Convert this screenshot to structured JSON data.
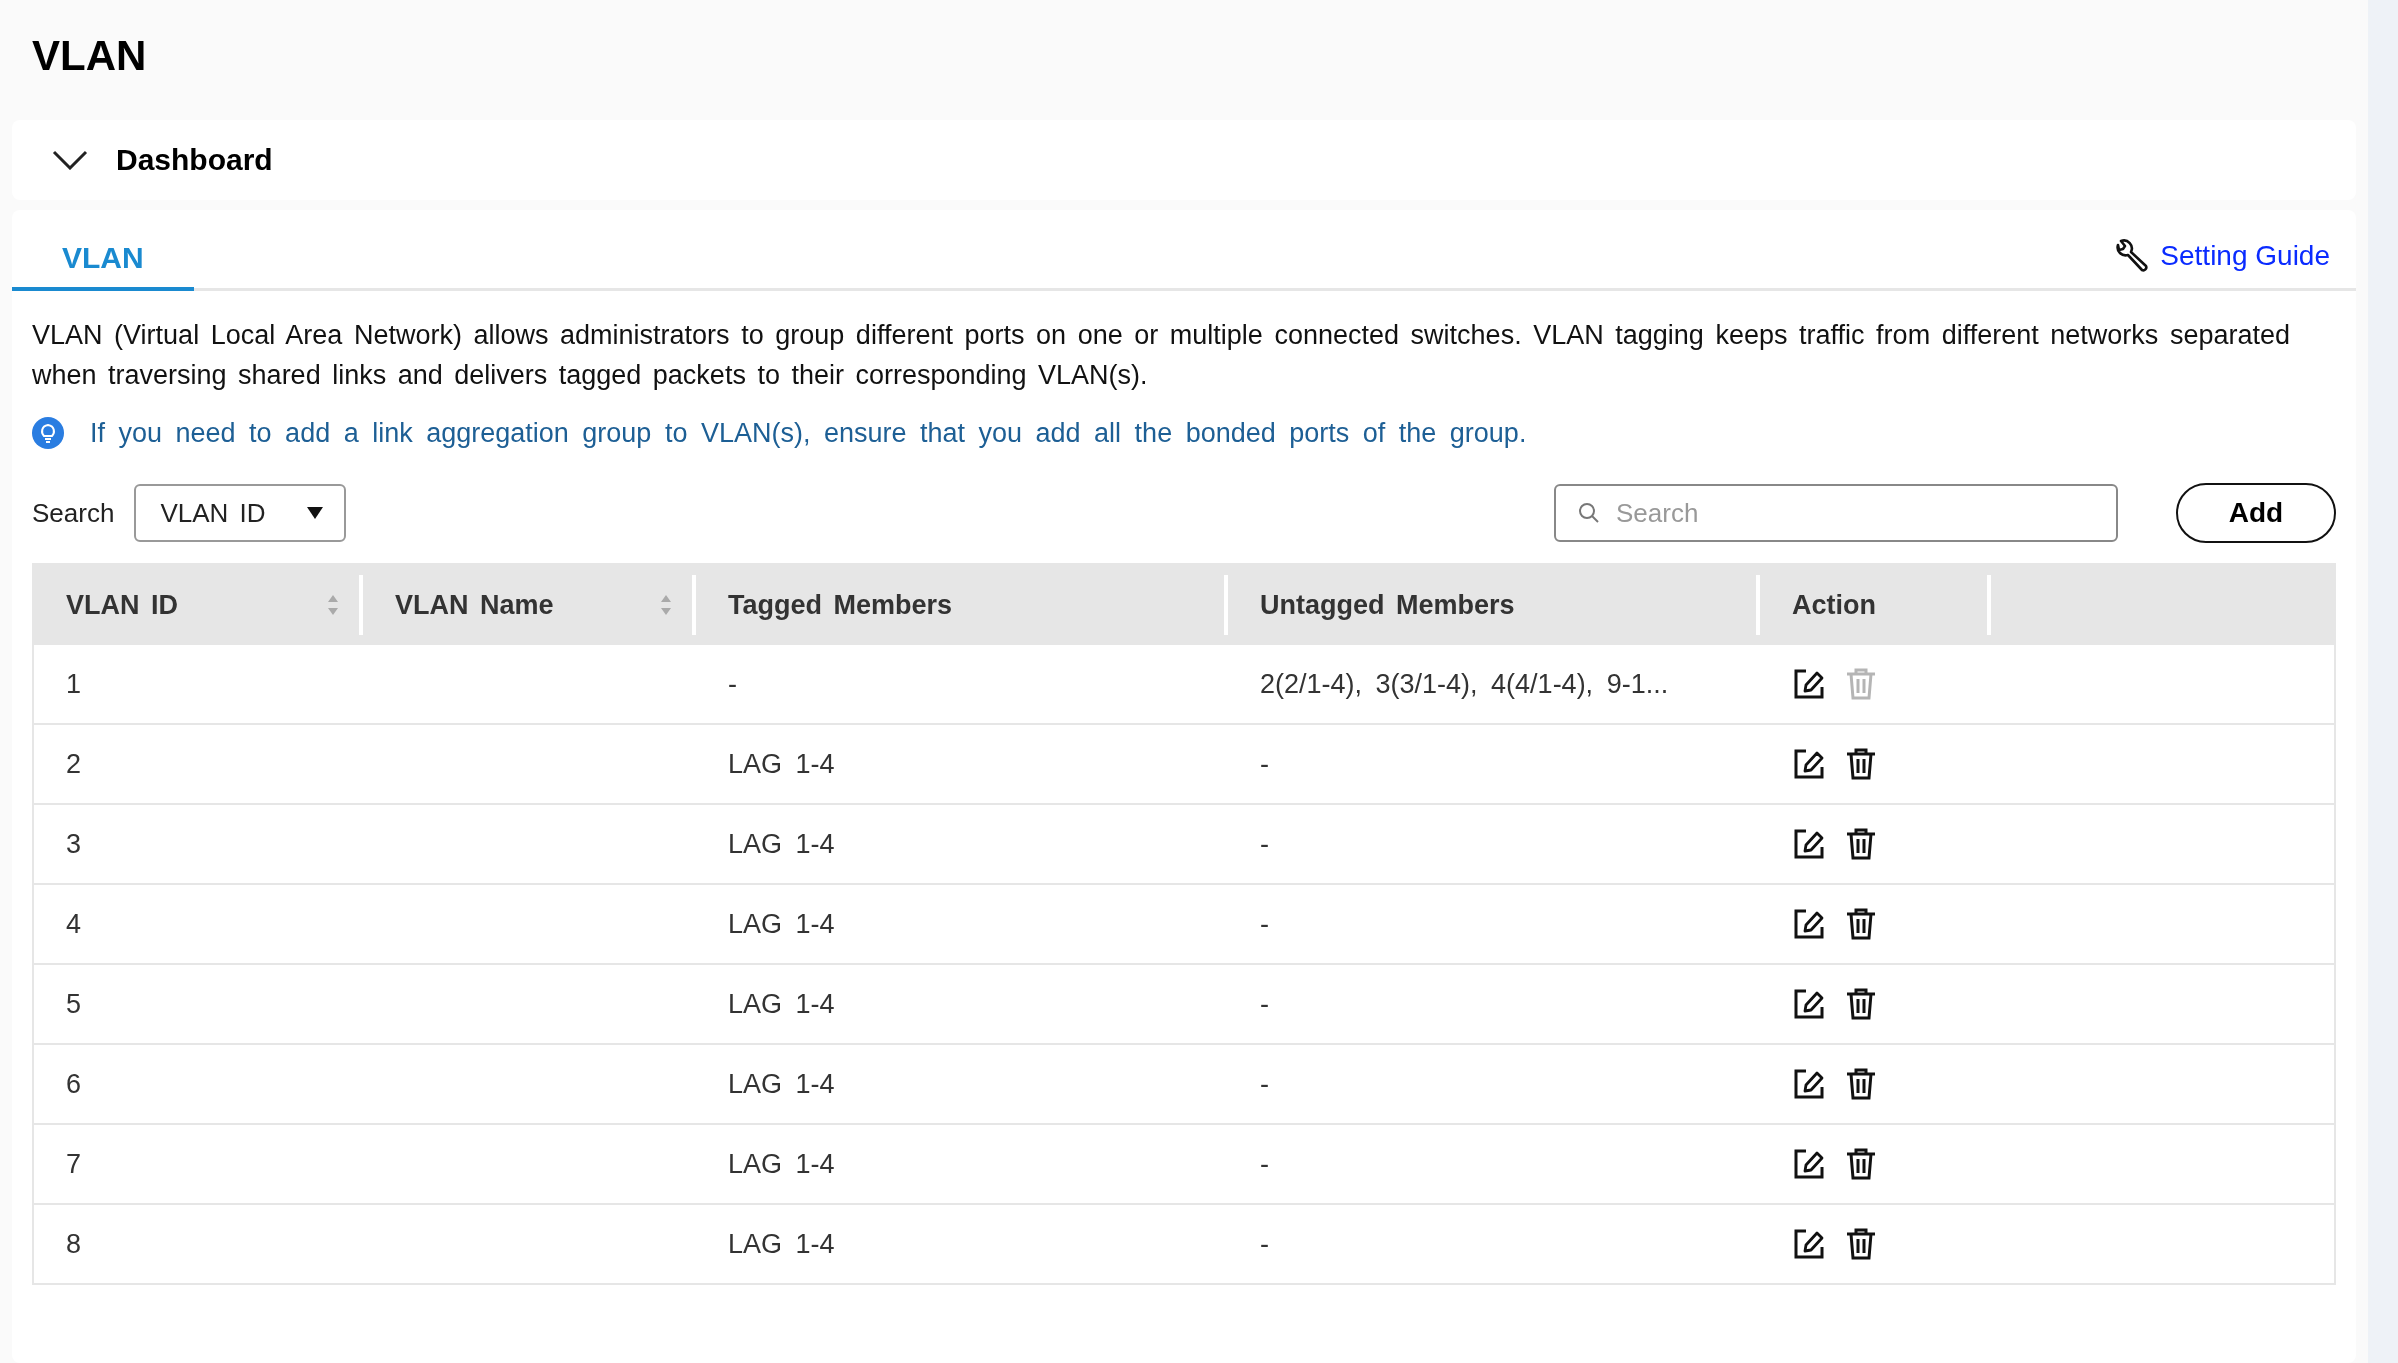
{
  "page_title": "VLAN",
  "dashboard": {
    "label": "Dashboard",
    "expanded": true
  },
  "tabs": [
    {
      "label": "VLAN",
      "selected": true
    }
  ],
  "setting_guide": "Setting Guide",
  "description": "VLAN (Virtual Local Area Network) allows administrators to group different ports on one or multiple connected switches. VLAN tagging keeps traffic from different networks separated when traversing shared links and delivers tagged packets to their corresponding VLAN(s).",
  "tip": "If you need to add a link aggregation group to VLAN(s), ensure that you add all the bonded ports of the group.",
  "search": {
    "label": "Search",
    "filter": "VLAN ID",
    "placeholder": "Search"
  },
  "add_button": "Add",
  "table": {
    "columns": [
      {
        "label": "VLAN ID",
        "sortable": true
      },
      {
        "label": "VLAN Name",
        "sortable": true
      },
      {
        "label": "Tagged Members",
        "sortable": false
      },
      {
        "label": "Untagged Members",
        "sortable": false
      },
      {
        "label": "Action",
        "sortable": false
      }
    ],
    "rows": [
      {
        "vlan_id": "1",
        "tagged": "-",
        "untagged": "2(2/1-4), 3(3/1-4), 4(4/1-4), 9-1...",
        "delete_disabled": true
      },
      {
        "vlan_id": "2",
        "tagged": "LAG 1-4",
        "untagged": "-",
        "delete_disabled": false
      },
      {
        "vlan_id": "3",
        "tagged": "LAG 1-4",
        "untagged": "-",
        "delete_disabled": false
      },
      {
        "vlan_id": "4",
        "tagged": "LAG 1-4",
        "untagged": "-",
        "delete_disabled": false
      },
      {
        "vlan_id": "5",
        "tagged": "LAG 1-4",
        "untagged": "-",
        "delete_disabled": false
      },
      {
        "vlan_id": "6",
        "tagged": "LAG 1-4",
        "untagged": "-",
        "delete_disabled": false
      },
      {
        "vlan_id": "7",
        "tagged": "LAG 1-4",
        "untagged": "-",
        "delete_disabled": false
      },
      {
        "vlan_id": "8",
        "tagged": "LAG 1-4",
        "untagged": "-",
        "delete_disabled": false
      }
    ]
  }
}
